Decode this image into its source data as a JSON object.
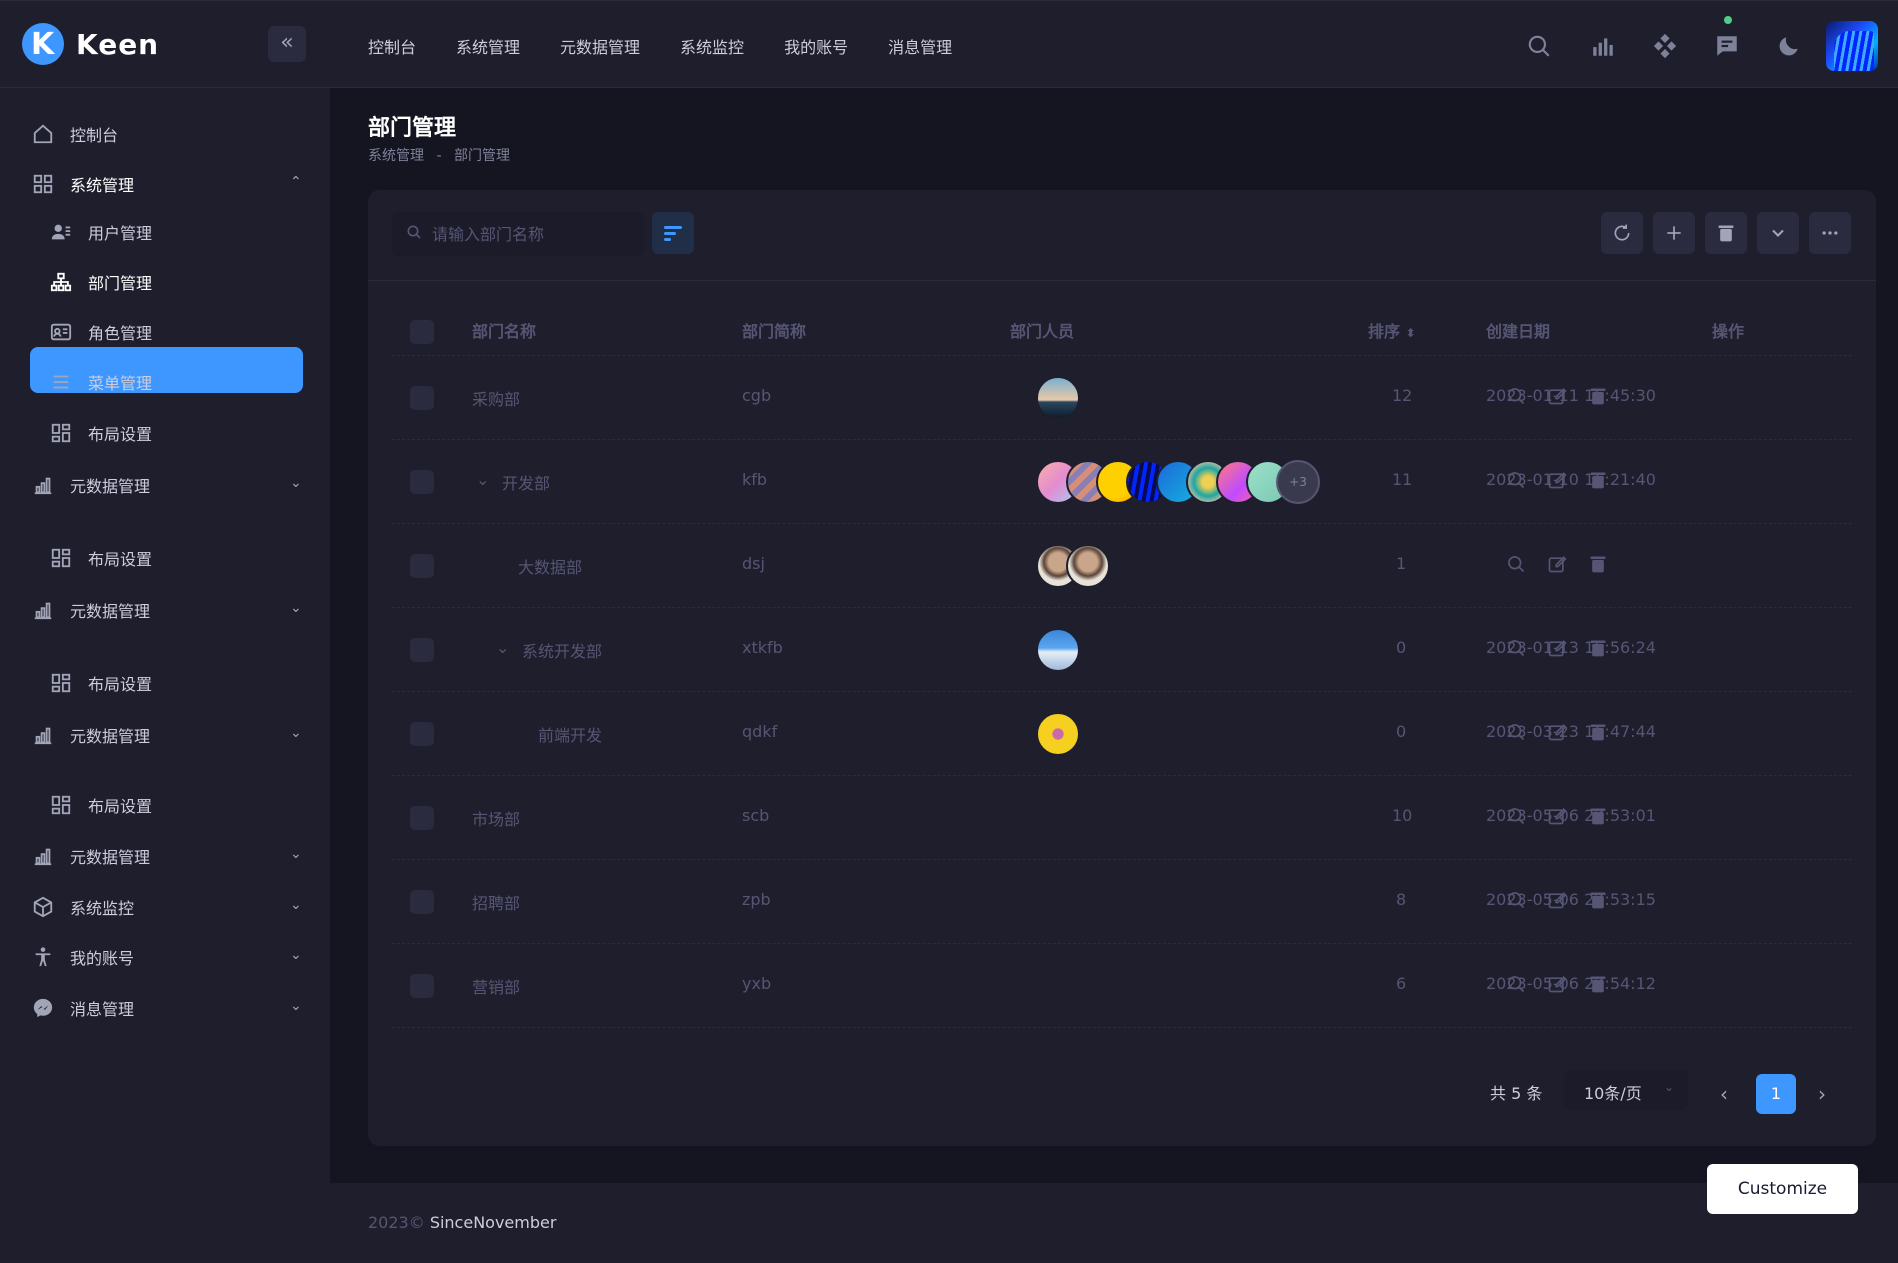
{
  "app": {
    "brand_name": "Keen",
    "collapse_icon": "double-chevron-left-icon"
  },
  "topnav": [
    "控制台",
    "系统管理",
    "元数据管理",
    "系统监控",
    "我的账号",
    "消息管理"
  ],
  "sidebar": {
    "items": [
      {
        "label": "控制台",
        "icon": "home-icon"
      },
      {
        "label": "系统管理",
        "icon": "grid-icon",
        "expanded": true
      },
      {
        "label": "用户管理",
        "icon": "users-icon"
      },
      {
        "label": "部门管理",
        "icon": "org-chart-icon",
        "active": true
      },
      {
        "label": "角色管理",
        "icon": "id-card-icon"
      },
      {
        "label": "菜单管理",
        "icon": "menu-icon"
      },
      {
        "label": "布局设置",
        "icon": "layout-icon"
      },
      {
        "label": "元数据管理",
        "icon": "bar-chart-icon"
      },
      {
        "label": "布局设置",
        "icon": "layout-icon"
      },
      {
        "label": "元数据管理",
        "icon": "bar-chart-icon"
      },
      {
        "label": "布局设置",
        "icon": "layout-icon"
      },
      {
        "label": "元数据管理",
        "icon": "bar-chart-icon"
      },
      {
        "label": "布局设置",
        "icon": "layout-icon"
      },
      {
        "label": "元数据管理",
        "icon": "bar-chart-icon"
      },
      {
        "label": "系统监控",
        "icon": "cube-icon"
      },
      {
        "label": "我的账号",
        "icon": "person-icon"
      },
      {
        "label": "消息管理",
        "icon": "messenger-icon"
      }
    ]
  },
  "page": {
    "title": "部门管理",
    "breadcrumb": [
      "系统管理",
      "-",
      "部门管理"
    ]
  },
  "search": {
    "placeholder": "请输入部门名称"
  },
  "table": {
    "headers": {
      "name": "部门名称",
      "short": "部门简称",
      "members": "部门人员",
      "sort": "排序",
      "created": "创建日期",
      "actions": "操作"
    },
    "rows": [
      {
        "name": "采购部",
        "short": "cgb",
        "sort": "12",
        "created": "2023-01-11 15:45:30"
      },
      {
        "name": "开发部",
        "short": "kfb",
        "sort": "11",
        "created": "2023-01-10 16:21:40",
        "more": "+3"
      },
      {
        "name": "大数据部",
        "short": "dsj",
        "sort": "1",
        "created": ""
      },
      {
        "name": "系统开发部",
        "short": "xtkfb",
        "sort": "0",
        "created": "2023-01-13 15:56:24"
      },
      {
        "name": "前端开发",
        "short": "qdkf",
        "sort": "0",
        "created": "2023-03-23 16:47:44"
      },
      {
        "name": "市场部",
        "short": "scb",
        "sort": "10",
        "created": "2023-05-06 22:53:01"
      },
      {
        "name": "招聘部",
        "short": "zpb",
        "sort": "8",
        "created": "2023-05-06 22:53:15"
      },
      {
        "name": "营销部",
        "short": "yxb",
        "sort": "6",
        "created": "2023-05-06 22:54:12"
      }
    ]
  },
  "pagination": {
    "total": "共 5 条",
    "page_size": "10条/页",
    "current": "1"
  },
  "footer": {
    "year": "2023©",
    "author": "SinceNovember"
  },
  "customize": "Customize",
  "colors": {
    "accent": "#3e97ff",
    "bg": "#151521",
    "panel": "#1e1e2d"
  }
}
